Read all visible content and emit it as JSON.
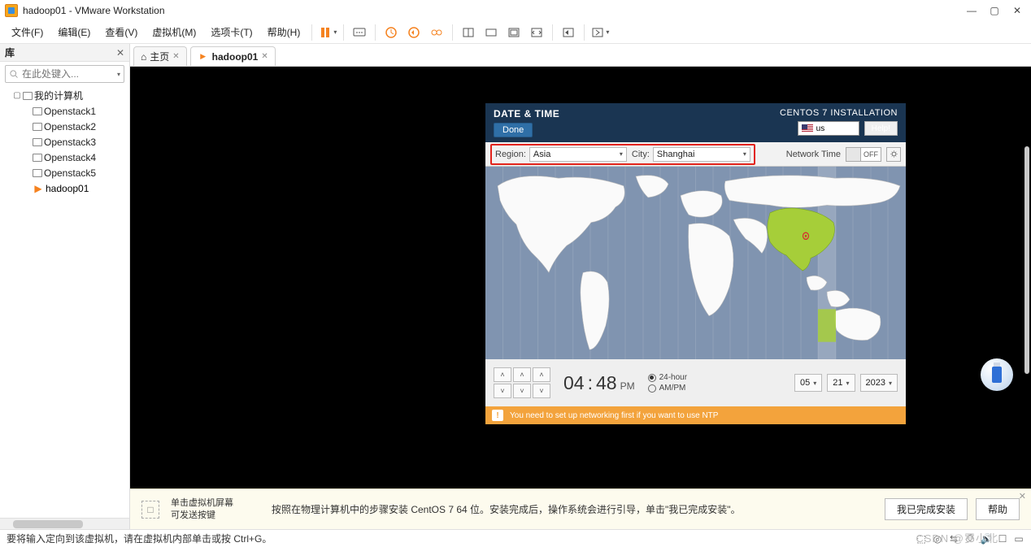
{
  "window": {
    "title": "hadoop01 - VMware Workstation"
  },
  "menubar": {
    "items": [
      "文件(F)",
      "编辑(E)",
      "查看(V)",
      "虚拟机(M)",
      "选项卡(T)",
      "帮助(H)"
    ]
  },
  "sidebar": {
    "header": "库",
    "search_placeholder": "在此处键入...",
    "root": "我的计算机",
    "items": [
      {
        "label": "Openstack1"
      },
      {
        "label": "Openstack2"
      },
      {
        "label": "Openstack3"
      },
      {
        "label": "Openstack4"
      },
      {
        "label": "Openstack5"
      },
      {
        "label": "hadoop01",
        "active": true
      }
    ]
  },
  "tabs": {
    "home": "主页",
    "active": "hadoop01"
  },
  "centos": {
    "header_title": "DATE & TIME",
    "install_title": "CENTOS 7 INSTALLATION",
    "done": "Done",
    "lang": "us",
    "help": "Help!",
    "region_label": "Region:",
    "region_value": "Asia",
    "city_label": "City:",
    "city_value": "Shanghai",
    "network_time_label": "Network Time",
    "network_time_state": "OFF",
    "time_h": "04",
    "time_m": "48",
    "ampm": "PM",
    "fmt24": "24-hour",
    "fmtap": "AM/PM",
    "date_day": "05",
    "date_month": "21",
    "date_year": "2023",
    "warn": "You need to set up networking first if you want to use NTP"
  },
  "hint": {
    "small1": "单击虚拟机屏幕",
    "small2": "可发送按键",
    "message": "按照在物理计算机中的步骤安装 CentOS 7 64 位。安装完成后，操作系统会进行引导，单击\"我已完成安装\"。",
    "btn_done": "我已完成安装",
    "btn_help": "帮助"
  },
  "status": {
    "text": "要将输入定向到该虚拟机，请在虚拟机内部单击或按 Ctrl+G。"
  },
  "watermark": "CSDN @罗小北"
}
